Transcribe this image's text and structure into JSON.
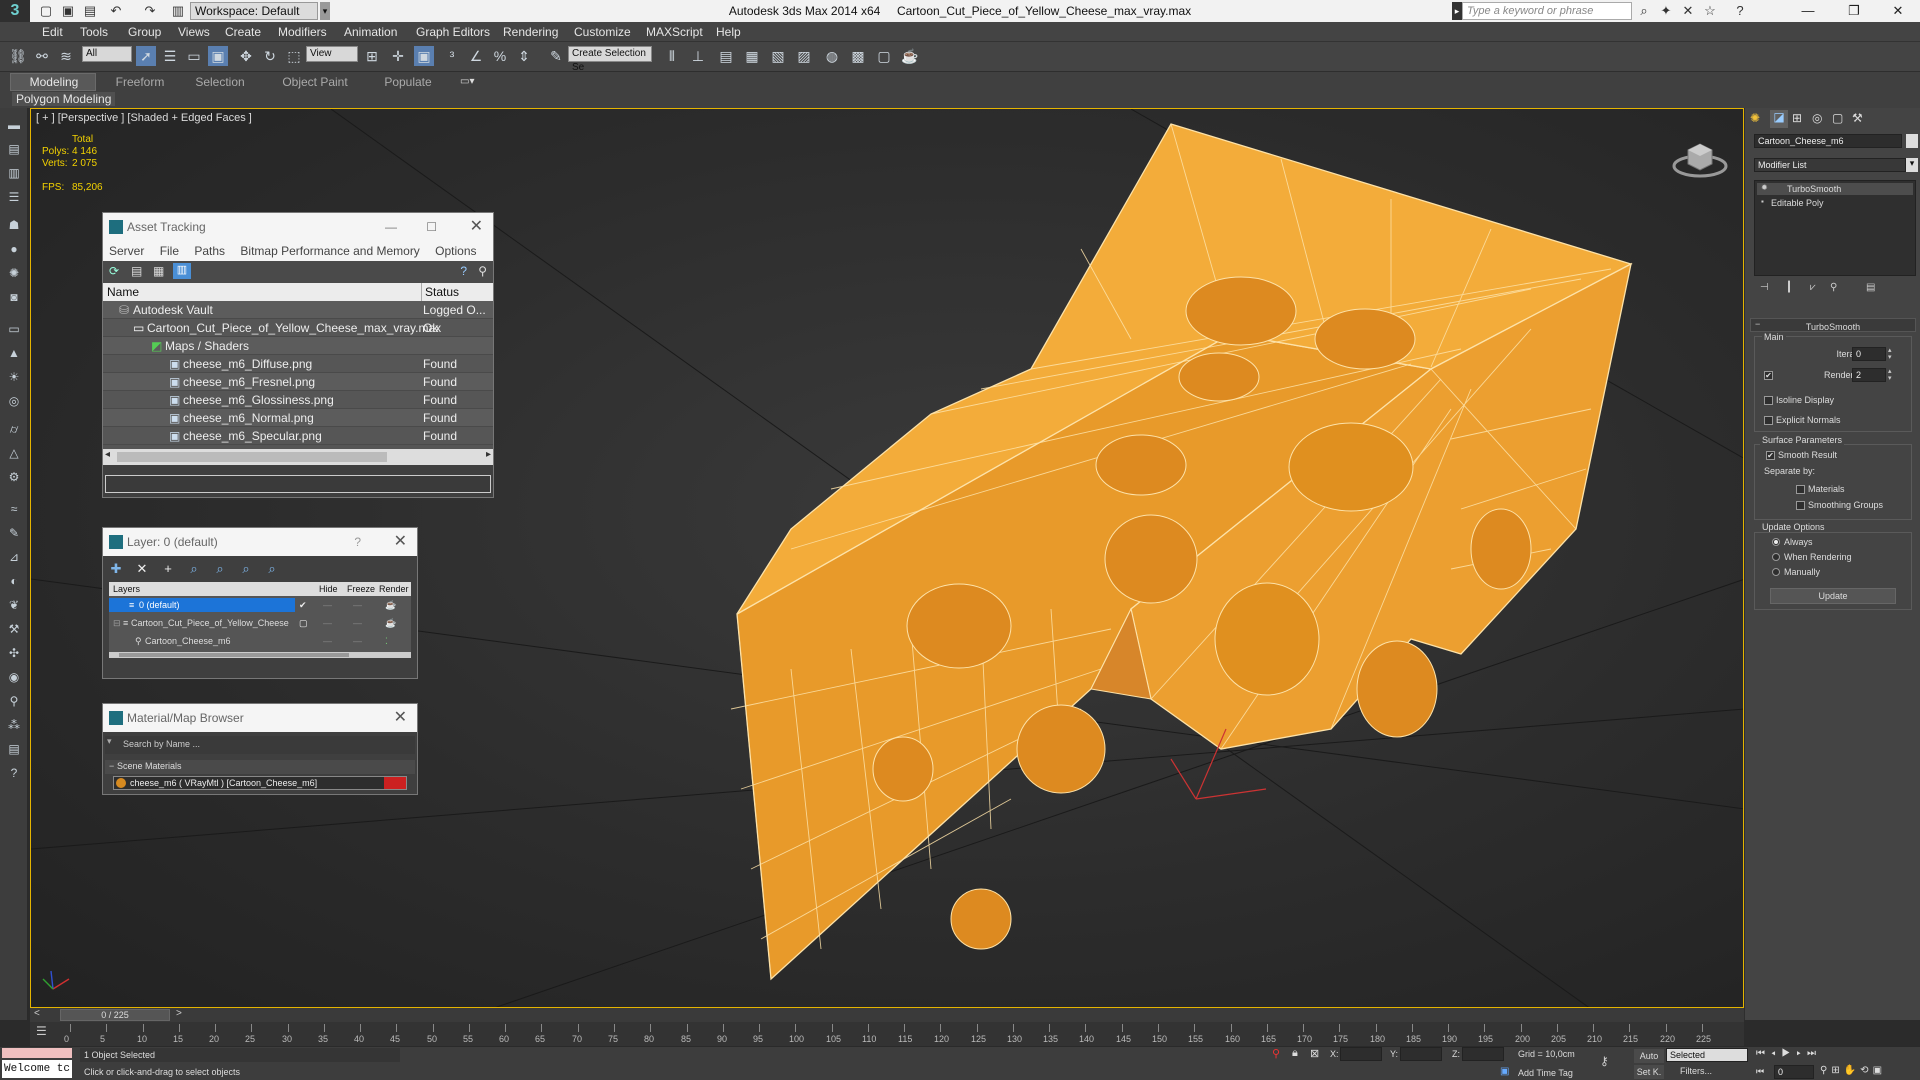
{
  "titlebar": {
    "workspace": "Workspace: Default",
    "app": "Autodesk 3ds Max  2014 x64",
    "file": "Cartoon_Cut_Piece_of_Yellow_Cheese_max_vray.max",
    "search_placeholder": "Type a keyword or phrase"
  },
  "menu": [
    "Edit",
    "Tools",
    "Group",
    "Views",
    "Create",
    "Modifiers",
    "Animation",
    "Graph Editors",
    "Rendering",
    "Customize",
    "MAXScript",
    "Help"
  ],
  "toolbar": {
    "filter": "All",
    "refcoord": "View",
    "selection_set": "Create Selection Se"
  },
  "ribbon": {
    "tabs": [
      "Modeling",
      "Freeform",
      "Selection",
      "Object Paint",
      "Populate"
    ],
    "panel_label": "Polygon Modeling"
  },
  "viewport": {
    "label": "[ + ] [Perspective ] [Shaded + Edged Faces ]",
    "stats": {
      "total_label": "Total",
      "polys_label": "Polys:",
      "polys": "4 146",
      "verts_label": "Verts:",
      "verts": "2 075",
      "fps_label": "FPS:",
      "fps": "85,206"
    }
  },
  "asset_tracking": {
    "title": "Asset Tracking",
    "menu": [
      "Server",
      "File",
      "Paths",
      "Bitmap Performance and Memory",
      "Options"
    ],
    "headers": {
      "name": "Name",
      "status": "Status"
    },
    "rows": [
      {
        "name": "Autodesk Vault",
        "status": "Logged O..."
      },
      {
        "name": "Cartoon_Cut_Piece_of_Yellow_Cheese_max_vray.max",
        "status": "Ok"
      },
      {
        "name": "Maps / Shaders",
        "status": ""
      },
      {
        "name": "cheese_m6_Diffuse.png",
        "status": "Found"
      },
      {
        "name": "cheese_m6_Fresnel.png",
        "status": "Found"
      },
      {
        "name": "cheese_m6_Glossiness.png",
        "status": "Found"
      },
      {
        "name": "cheese_m6_Normal.png",
        "status": "Found"
      },
      {
        "name": "cheese_m6_Specular.png",
        "status": "Found"
      }
    ]
  },
  "layer_dialog": {
    "title": "Layer: 0 (default)",
    "help": "?",
    "headers": {
      "layers": "Layers",
      "hide": "Hide",
      "freeze": "Freeze",
      "render": "Render"
    },
    "rows": [
      {
        "name": "0 (default)"
      },
      {
        "name": "Cartoon_Cut_Piece_of_Yellow_Cheese"
      },
      {
        "name": "Cartoon_Cheese_m6"
      }
    ]
  },
  "material_browser": {
    "title": "Material/Map Browser",
    "search_placeholder": "Search by Name ...",
    "group": "Scene Materials",
    "item": "cheese_m6  ( VRayMtl ) [Cartoon_Cheese_m6]"
  },
  "command_panel": {
    "object_name": "Cartoon_Cheese_m6",
    "modifier_list": "Modifier List",
    "stack": [
      "TurboSmooth",
      "Editable Poly"
    ],
    "rollout_title": "TurboSmooth",
    "main_label": "Main",
    "iterations_label": "Iterations:",
    "iterations": "0",
    "render_iters_label": "Render Iters:",
    "render_iters": "2",
    "isoline": "Isoline Display",
    "explicit_normals": "Explicit Normals",
    "surface_params": "Surface Parameters",
    "smooth_result": "Smooth Result",
    "separate_by": "Separate by:",
    "materials": "Materials",
    "smoothing_groups": "Smoothing Groups",
    "update_options": "Update Options",
    "always": "Always",
    "when_rendering": "When Rendering",
    "manually": "Manually",
    "update_button": "Update"
  },
  "timeline": {
    "frame": "0 / 225",
    "ticks": [
      "0",
      "5",
      "10",
      "15",
      "20",
      "25",
      "30",
      "35",
      "40",
      "45",
      "50",
      "55",
      "60",
      "65",
      "70",
      "75",
      "80",
      "85",
      "90",
      "95",
      "100",
      "105",
      "110",
      "115",
      "120",
      "125",
      "130",
      "135",
      "140",
      "145",
      "150",
      "155",
      "160",
      "165",
      "170",
      "175",
      "180",
      "185",
      "190",
      "195",
      "200",
      "205",
      "210",
      "215",
      "220",
      "225"
    ]
  },
  "statusbar": {
    "maxscript": "Welcome tc",
    "selected": "1 Object Selected",
    "prompt": "Click or click-and-drag to select objects",
    "x_label": "X:",
    "y_label": "Y:",
    "z_label": "Z:",
    "grid": "Grid = 10,0cm",
    "add_time_tag": "Add Time Tag",
    "auto": "Auto",
    "set_k": "Set K.",
    "key_mode": "Selected",
    "filters": "Filters...",
    "frame_field": "0"
  },
  "colors": {
    "cheese": "#f0a030",
    "wire": "#ffe0a0",
    "viewport_border": "#e4b400"
  }
}
